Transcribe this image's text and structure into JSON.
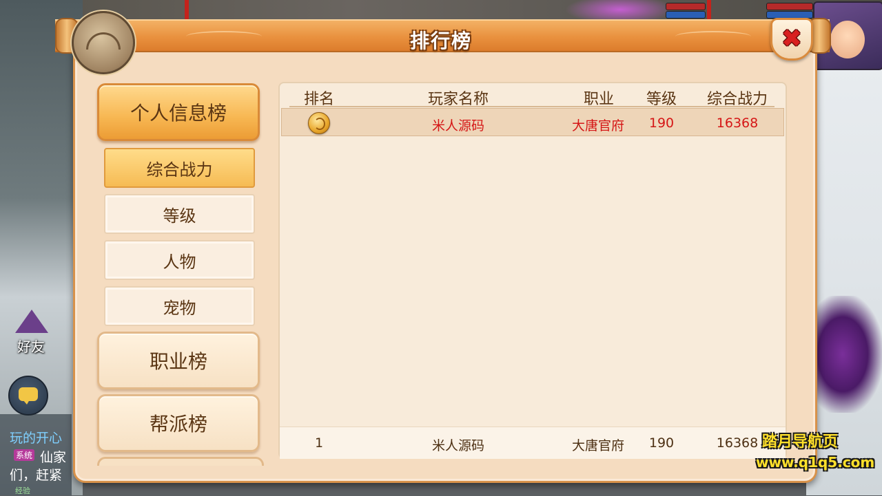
{
  "panel": {
    "title": "排行榜",
    "close_icon": "close-x-icon"
  },
  "menu": {
    "categories": [
      {
        "label": "个人信息榜",
        "active": true
      },
      {
        "label": "职业榜",
        "active": false
      },
      {
        "label": "帮派榜",
        "active": false
      }
    ],
    "subtabs": [
      {
        "label": "综合战力",
        "active": true
      },
      {
        "label": "等级",
        "active": false
      },
      {
        "label": "人物",
        "active": false
      },
      {
        "label": "宠物",
        "active": false
      }
    ]
  },
  "table": {
    "headers": [
      "排名",
      "玩家名称",
      "职业",
      "等级",
      "综合战力"
    ],
    "rows": [
      {
        "rank_icon": "gold-medal-icon",
        "name": "米人源码",
        "class": "大唐官府",
        "level": "190",
        "power": "16368"
      }
    ],
    "my_rank": {
      "rank": "1",
      "name": "米人源码",
      "class": "大唐官府",
      "level": "190",
      "power": "16368"
    }
  },
  "hud": {
    "friend_label": "好友",
    "chat_lines": [
      "玩的开心",
      "仙家",
      "们，赶紧"
    ],
    "chat_tag": "系统",
    "exp_label": "经验"
  },
  "watermark": {
    "line1": "踏月导航页",
    "line2": "www.q1q5.com"
  },
  "colors": {
    "accent_orange": "#ec9c35",
    "highlight_red": "#d51616",
    "panel_bg": "#f5dcc0"
  }
}
